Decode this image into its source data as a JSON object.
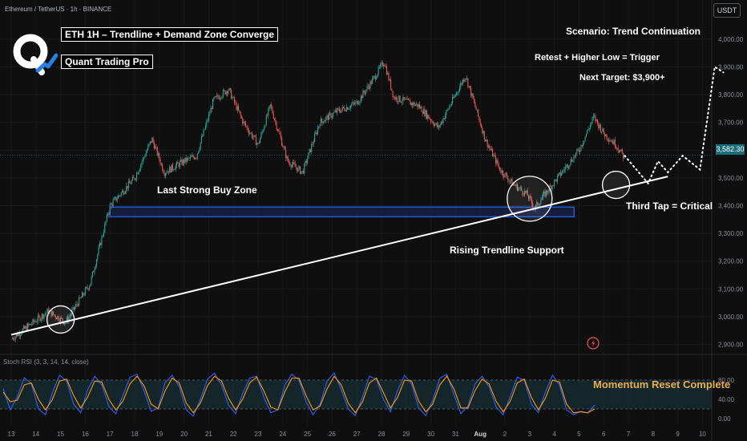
{
  "header": {
    "symbol_line": "Ethereum / TetherUS · 1h · BINANCE",
    "unit_label": "USDT",
    "current_price_label": "3,582.30"
  },
  "titles": {
    "main": "ETH 1H – Trendline + Demand Zone Converge",
    "brand": "Quant Trading Pro"
  },
  "annotations": {
    "scenario": "Scenario: Trend Continuation",
    "retest": "Retest + Higher Low = Trigger",
    "target": "Next Target: $3,900+",
    "buy_zone": "Last Strong Buy Zone",
    "third_tap": "Third Tap = Critical",
    "trendline": "Rising Trendline Support",
    "momentum": "Momentum Reset Complete"
  },
  "rsi_header": "Stoch RSI (3, 3, 14, 14, close)",
  "colors": {
    "background": "#0f0f0f",
    "bull_candle": "#26a69a",
    "bear_candle": "#ef5350",
    "zone_border": "#2962ff",
    "zone_fill": "#1a2a66",
    "rsi_k": "#2962ff",
    "rsi_d": "#ff9800",
    "rsi_band": "#1b3a44",
    "highlight": "#e8b04a",
    "brand_blue": "#2a7de1"
  },
  "icons": [
    "logo-q-icon",
    "brand-arrow-icon",
    "lightning-icon"
  ],
  "chart_data": [
    {
      "type": "candlestick",
      "y_ticks": [
        "4,000.00",
        "3,900.00",
        "3,800.00",
        "3,700.00",
        "3,600.00",
        "3,500.00",
        "3,400.00",
        "3,300.00",
        "3,200.00",
        "3,100.00",
        "3,000.00",
        "2,900.00"
      ],
      "y_tick_values": [
        4000,
        3900,
        3800,
        3700,
        3600,
        3500,
        3400,
        3300,
        3200,
        3100,
        3000,
        2900
      ],
      "ylim": [
        2870,
        4060
      ],
      "x_ticks": [
        "13",
        "14",
        "15",
        "16",
        "17",
        "18",
        "19",
        "20",
        "21",
        "22",
        "23",
        "24",
        "25",
        "26",
        "27",
        "28",
        "29",
        "30",
        "31",
        "Aug",
        "2",
        "3",
        "4",
        "5",
        "6",
        "7",
        "8",
        "9",
        "10"
      ],
      "price_path": [
        [
          0,
          2920
        ],
        [
          1.5,
          3020
        ],
        [
          2.2,
          2980
        ],
        [
          3.2,
          3120
        ],
        [
          4.0,
          3400
        ],
        [
          5.0,
          3500
        ],
        [
          5.7,
          3640
        ],
        [
          6.2,
          3520
        ],
        [
          7.0,
          3560
        ],
        [
          7.5,
          3580
        ],
        [
          8.2,
          3780
        ],
        [
          8.8,
          3820
        ],
        [
          9.4,
          3700
        ],
        [
          10.0,
          3620
        ],
        [
          10.5,
          3760
        ],
        [
          11.2,
          3560
        ],
        [
          11.8,
          3520
        ],
        [
          12.5,
          3700
        ],
        [
          13.2,
          3740
        ],
        [
          14.0,
          3770
        ],
        [
          14.7,
          3860
        ],
        [
          15.1,
          3920
        ],
        [
          15.5,
          3790
        ],
        [
          16.5,
          3760
        ],
        [
          17.3,
          3680
        ],
        [
          18.0,
          3800
        ],
        [
          18.4,
          3870
        ],
        [
          19.2,
          3640
        ],
        [
          19.8,
          3530
        ],
        [
          20.3,
          3480
        ],
        [
          20.9,
          3440
        ],
        [
          21.2,
          3390
        ],
        [
          21.6,
          3440
        ],
        [
          22.3,
          3520
        ],
        [
          23.0,
          3600
        ],
        [
          23.6,
          3720
        ],
        [
          24.0,
          3660
        ],
        [
          24.5,
          3620
        ],
        [
          24.85,
          3570
        ]
      ],
      "trendline": {
        "from": [
          0,
          2935
        ],
        "to": [
          26.6,
          3505
        ],
        "label": "Rising Trendline Support"
      },
      "demand_zone": {
        "x_range": [
          4.0,
          22.8
        ],
        "y_range": [
          3360,
          3395
        ],
        "label": "Last Strong Buy Zone"
      },
      "projection": [
        [
          24.85,
          3580
        ],
        [
          25.8,
          3480
        ],
        [
          26.2,
          3560
        ],
        [
          26.6,
          3520
        ],
        [
          27.2,
          3580
        ],
        [
          27.9,
          3530
        ],
        [
          28.5,
          3900
        ],
        [
          28.85,
          3880
        ]
      ],
      "circled_taps": [
        [
          2.0,
          2990
        ],
        [
          21.0,
          3425
        ],
        [
          24.5,
          3475
        ]
      ],
      "current_price": 3582.3
    },
    {
      "type": "line",
      "title": "Stoch RSI (3, 3, 14, 14, close)",
      "y_ticks": [
        "80.00",
        "40.00",
        "0.00"
      ],
      "y_tick_values": [
        80,
        40,
        0
      ],
      "ylim": [
        0,
        100
      ],
      "band": [
        20,
        80
      ],
      "series": [
        {
          "name": "K",
          "values": [
            62,
            18,
            45,
            85,
            72,
            20,
            8,
            55,
            90,
            78,
            30,
            12,
            60,
            88,
            70,
            25,
            10,
            48,
            86,
            92,
            58,
            15,
            22,
            75,
            90,
            66,
            18,
            5,
            40,
            82,
            94,
            70,
            28,
            10,
            52,
            84,
            88,
            45,
            12,
            18,
            70,
            92,
            80,
            35,
            8,
            30,
            78,
            95,
            60,
            20,
            6,
            44,
            88,
            82,
            40,
            14,
            58,
            90,
            72,
            22,
            6,
            38,
            84,
            92,
            50,
            10,
            26,
            72,
            88,
            66,
            24,
            8,
            46,
            86,
            80,
            30,
            12,
            55,
            90,
            70,
            18,
            8,
            15,
            12,
            28
          ]
        },
        {
          "name": "D",
          "values": [
            55,
            35,
            38,
            70,
            74,
            40,
            18,
            40,
            78,
            82,
            48,
            22,
            45,
            78,
            76,
            40,
            18,
            36,
            72,
            88,
            68,
            30,
            20,
            58,
            84,
            74,
            32,
            12,
            32,
            68,
            88,
            78,
            42,
            18,
            40,
            74,
            86,
            58,
            24,
            18,
            56,
            84,
            84,
            48,
            18,
            26,
            62,
            88,
            70,
            32,
            12,
            34,
            74,
            84,
            54,
            22,
            44,
            80,
            78,
            36,
            14,
            30,
            70,
            88,
            62,
            22,
            22,
            58,
            82,
            72,
            36,
            14,
            36,
            74,
            82,
            44,
            18,
            42,
            80,
            76,
            30,
            12,
            14,
            12,
            20
          ]
        }
      ]
    }
  ]
}
